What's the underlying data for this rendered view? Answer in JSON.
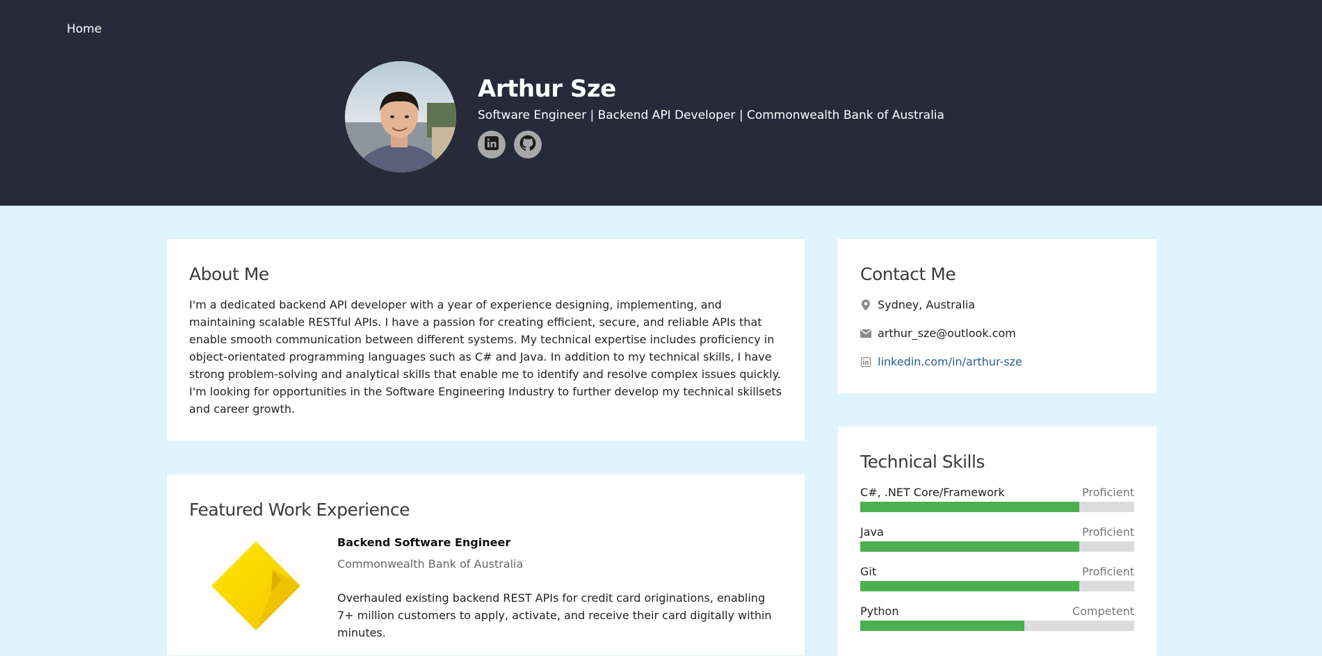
{
  "nav": {
    "home_label": "Home"
  },
  "profile": {
    "name": "Arthur Sze",
    "headline": "Software Engineer | Backend API Developer | Commonwealth Bank of Australia",
    "socials": [
      {
        "icon": "linkedin-icon"
      },
      {
        "icon": "github-icon"
      }
    ]
  },
  "about": {
    "title": "About Me",
    "text": "I'm a dedicated backend API developer with a year of experience designing, implementing, and maintaining scalable RESTful APIs. I have a passion for creating efficient, secure, and reliable APIs that enable smooth communication between different systems. My technical expertise includes proficiency in object-orientated programming languages such as C# and Java. In addition to my technical skills, I have strong problem-solving and analytical skills that enable me to identify and resolve complex issues quickly. I'm looking for opportunities in the Software Engineering Industry to further develop my technical skillsets and career growth."
  },
  "work": {
    "title": "Featured Work Experience",
    "jobs": [
      {
        "title": "Backend Software Engineer",
        "company": "Commonwealth Bank of Australia",
        "description": "Overhauled existing backend REST APIs for credit card originations, enabling 7+ million customers to apply, activate, and receive their card digitally within minutes."
      }
    ]
  },
  "contact": {
    "title": "Contact Me",
    "location": "Sydney, Australia",
    "email": "arthur_sze@outlook.com",
    "linkedin": "linkedin.com/in/arthur-sze"
  },
  "skills": {
    "title": "Technical Skills",
    "items": [
      {
        "name": "C#, .NET Core/Framework",
        "level": "Proficient",
        "fill": 0.8
      },
      {
        "name": "Java",
        "level": "Proficient",
        "fill": 0.8
      },
      {
        "name": "Git",
        "level": "Proficient",
        "fill": 0.8
      },
      {
        "name": "Python",
        "level": "Competent",
        "fill": 0.6
      }
    ]
  },
  "colors": {
    "header_bg": "#272a3a",
    "page_bg": "#dff4fc",
    "skill_fill": "#4caf50",
    "skill_track": "#dcdcdc",
    "link": "#2c5d8e",
    "logo_yellow": "#ffd400"
  }
}
